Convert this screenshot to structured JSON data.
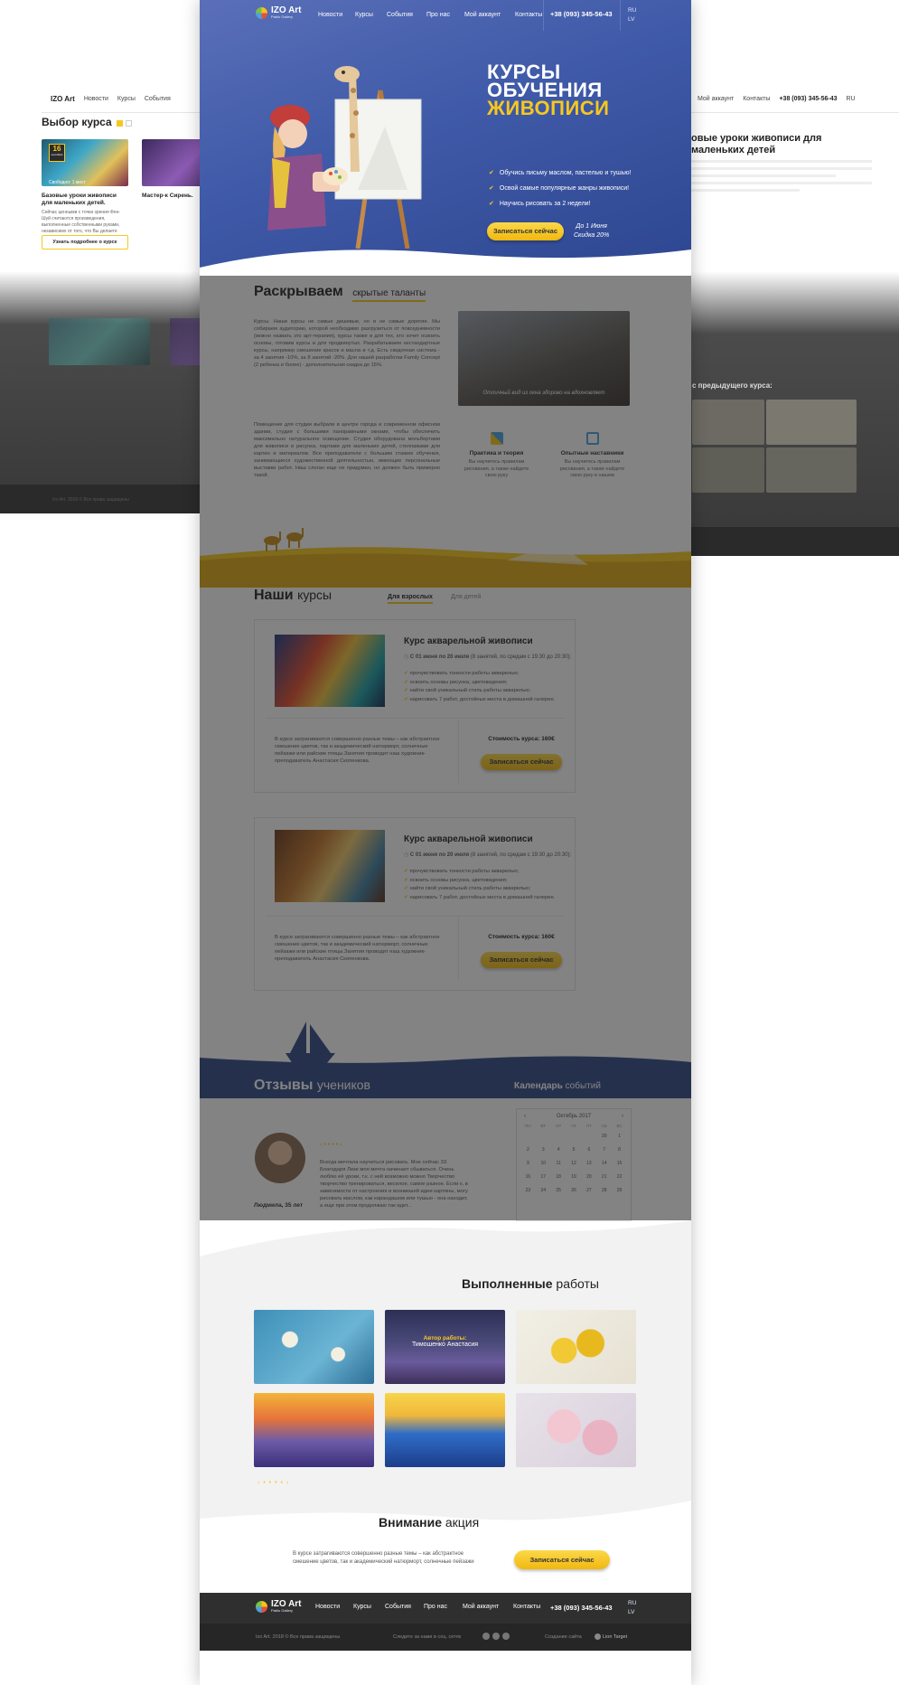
{
  "colors": {
    "primary": "#3f5aa8",
    "accent": "#f6c81e",
    "dark": "#2f2f2f"
  },
  "nav": {
    "logo": "IZO Art",
    "logo_sub": "Pablo Gallery",
    "items": [
      "Новости",
      "Курсы",
      "События",
      "Про нас",
      "Мой аккаунт",
      "Контакты"
    ],
    "phone": "+38 (093) 345-56-43",
    "lang_ru": "RU",
    "lang_lv": "LV"
  },
  "hero": {
    "title_line1": "КУРСЫ",
    "title_line2": "ОБУЧЕНИЯ",
    "title_line3": "ЖИВОПИСИ",
    "bullets": [
      "Обучись письму маслом, пастелью и тушью!",
      "Освой самые популярные жанры живописи!",
      "Научись рисовать за 2 недели!"
    ],
    "cta": "Записаться сейчас",
    "promo_line1": "До 1 Июня",
    "promo_line2": "Скидка 20%"
  },
  "reveal": {
    "title_bold": "Раскрываем",
    "title_light": "скрытые таланты",
    "para1": "Курсы. Наши курсы не самые дешевые, но и не самые дорогие. Мы собираем аудиторию, которой необходимо разгрузиться от повседневности (можно назвать это арт-терапия), курсы также и для тех, кто хочет освоить основы, готовим курсы и для продвинутых. Разрабатываем нестандартные курсы, например смешение красок и масла и т.д. Есть скидочная система - за 4 занятия -10%, за 8 занятий -20%. Для нашей разработки Family Concept (2 ребенка и более) - дополнительная скидка до 15%.",
    "para2": "Помещение для студии выбрали в центре города и современном офисном здании, студия с большими панорамными окнами, чтобы обеспечить максимально натуральное освещение. Студия оборудована мольбертами для живописи и рисунка, партами для маленьких детей, стеллажами для картин и материалов. Все преподаватели с большим стажем обучения, занимающиеся художественной деятельностью, имеющие персональные выставки работ. Наш слоган еще не придуман, но должен быть примерно такой.",
    "photo_caption": "Отличный вид из окна здорово на вдохновляет",
    "fact1_title": "Практика и теория",
    "fact1_text": "Вы научитесь правилам рисования, а также найдете свою руку",
    "fact2_title": "Опытные наставники",
    "fact2_text": "Вы научитесь правилам рисования, а также найдете свою руку в нашем"
  },
  "courses": {
    "title_bold": "Наши",
    "title_light": "курсы",
    "tab_adults": "Для взрослых",
    "tab_kids": "Для детей",
    "items": [
      {
        "name": "Курс акварельной живописи",
        "date_bold": "С 01 июня по 20 июля",
        "date_rest": "(8 занятий, по средам с 19:30 до 20:30);",
        "features": [
          "прочувствовать тонкости работы акварелью;",
          "освоить основы рисунка, цветоведения;",
          "найти свой уникальный стиль работы акварелью;",
          "нарисовать 7 работ, достойных места в домашней галерее."
        ],
        "desc": "В курсе затрагиваются совершенно разные темы – как абстрактное смешение цветов, так и академический натюрморт, солнечные пейзажи или райские птицы.Занятия проводит наш художник-преподаватель Анастасия Скопенкова.",
        "price": "Стоимость курса: 160€",
        "cta": "Записаться сейчас"
      },
      {
        "name": "Курс акварельной живописи",
        "date_bold": "С 01 июня по 20 июля",
        "date_rest": "(8 занятий, по средам с 19:30 до 20:30);",
        "features": [
          "прочувствовать тонкости работы акварелью;",
          "освоить основы рисунка, цветоведения;",
          "найти свой уникальный стиль работы акварелью;",
          "нарисовать 7 работ, достойных места в домашней галерее."
        ],
        "desc": "В курсе затрагиваются совершенно разные темы – как абстрактное смешение цветов, так и академический натюрморт, солнечные пейзажи или райские птицы.Занятия проводит наш художник-преподаватель Анастасия Скопенкова.",
        "price": "Стоимость курса: 160€",
        "cta": "Записаться сейчас"
      }
    ]
  },
  "reviews": {
    "title_bold": "Отзывы",
    "title_light": "учеников",
    "author": "Людмила, 35 лет",
    "text": "Всегда мечтала научиться рисовать. Мне сейчас 33. Благодаря Лизе моя мечта начинает сбываться. Очень люблю её уроки, т.к. с ней возможно можно Творчество творчество тренироваться, веселое, самое разное. Если к, в зависимости от настроения и возникшей идеи картины, могу рисовать маслом, как карандашом или тушью - она находит, а еще при этом продолжаю так идет..."
  },
  "calendar": {
    "title_bold": "Календарь",
    "title_light": "событий",
    "month": "Октябрь 2017",
    "weekdays": [
      "ПН",
      "ВТ",
      "СР",
      "ЧТ",
      "ПТ",
      "СБ",
      "ВС"
    ],
    "days": [
      "",
      "",
      "",
      "",
      "",
      "30",
      "1",
      "2",
      "3",
      "4",
      "5",
      "6",
      "7",
      "8",
      "9",
      "10",
      "11",
      "12",
      "13",
      "14",
      "15",
      "16",
      "17",
      "18",
      "19",
      "20",
      "21",
      "22",
      "23",
      "24",
      "25",
      "26",
      "27",
      "28",
      "29"
    ]
  },
  "works": {
    "title_bold": "Выполненные",
    "title_light": "работы",
    "hover_label": "Автор работы:",
    "hover_author": "Тимошенко Анастасия"
  },
  "promo": {
    "title_bold": "Внимание",
    "title_light": "акция",
    "text": "В курсе затрагиваются совершенно разные темы – как абстрактное смешение цветов, так и академический натюрморт, солнечные пейзажи",
    "cta": "Записаться сейчас"
  },
  "footer": {
    "copyright": "Izo Art. 2018 © Все права защищены",
    "follow": "Следите за нами в соц. сетях",
    "made": "Создание сайта",
    "studio": "Lion Target"
  },
  "left_page": {
    "title": "Выбор курса",
    "card1_title": "Базовые уроки живописи для маленьких детей.",
    "card1_text": "Сейчас ценными с точки зрения Фен-Шуй считаются произведения, выполненные собственными руками, независимо от того, что Вы делаете",
    "card1_badge_day": "16",
    "card1_badge_month": "сентября",
    "card1_meta": "Свободно: 1 мест",
    "card2_title": "Мастер-к Сирень.",
    "card_btn": "Узнать подробнее о курсе",
    "footer": "Izo Art. 2018 © Все права защищены"
  },
  "right_page": {
    "title": "овые уроки живописи для маленьких детей",
    "gallery_title": "с предыдущего курса:"
  }
}
